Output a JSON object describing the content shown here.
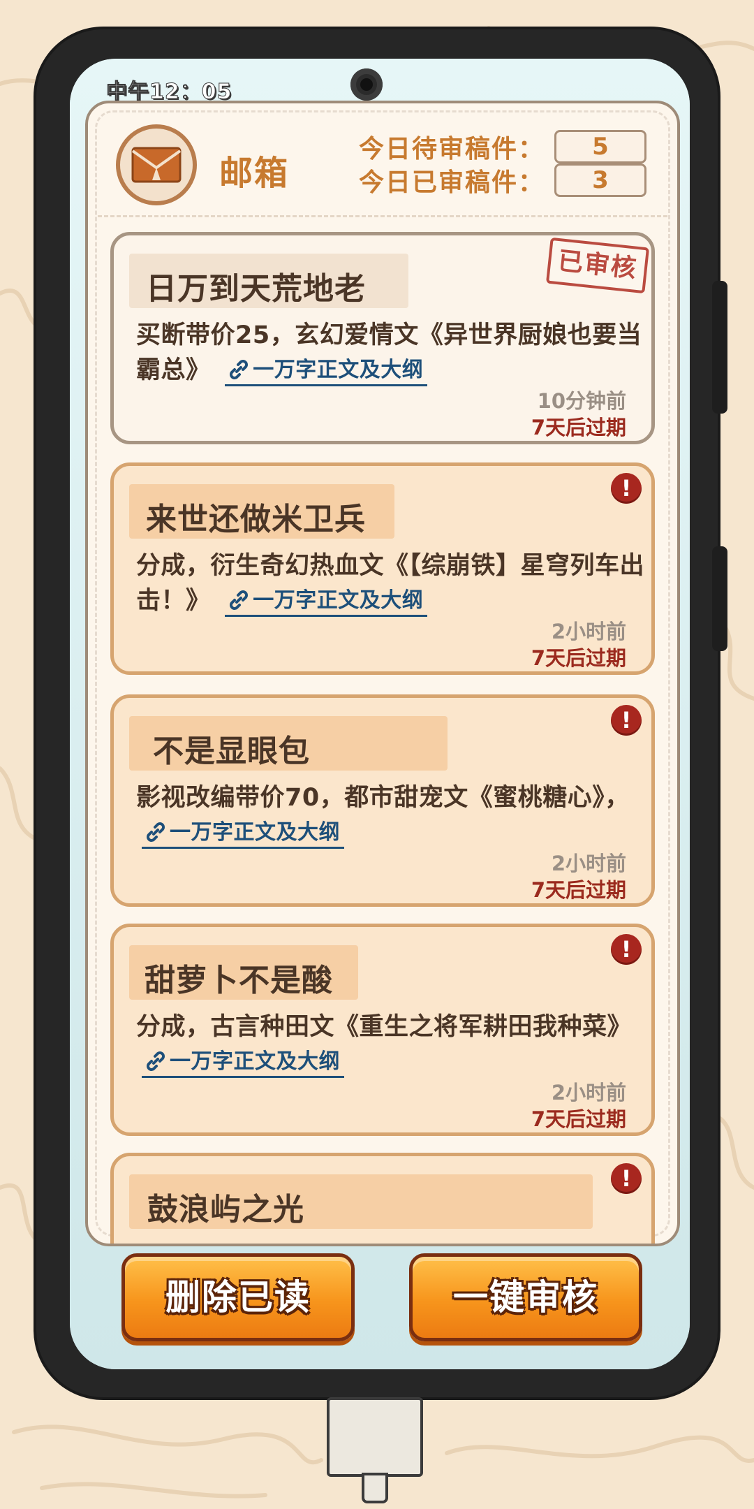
{
  "status_bar": {
    "time": "中午12：05"
  },
  "mailbox": {
    "title": "邮箱",
    "icon": "envelope-icon",
    "pending_label": "今日待审稿件：",
    "pending_count": "5",
    "reviewed_label": "今日已审稿件：",
    "reviewed_count": "3"
  },
  "mails": [
    {
      "title": "日万到天荒地老",
      "desc": "买断带价25，玄幻爱情文《异世界厨娘也要当霸总》",
      "link": "一万字正文及大纲",
      "time": "10分钟前",
      "expire": "7天后过期",
      "status": "已审核",
      "read": true
    },
    {
      "title": "来世还做米卫兵",
      "desc": "分成，衍生奇幻热血文《【综崩铁】星穹列车出击！》",
      "link": "一万字正文及大纲",
      "time": "2小时前",
      "expire": "7天后过期",
      "status_icon": "exclamation-icon",
      "read": false
    },
    {
      "title": "不是显眼包",
      "desc": "影视改编带价70，都市甜宠文《蜜桃糖心》，",
      "link": "一万字正文及大纲",
      "time": "2小时前",
      "expire": "7天后过期",
      "status_icon": "exclamation-icon",
      "read": false
    },
    {
      "title": "甜萝卜不是酸",
      "desc": "分成，古言种田文《重生之将军耕田我种菜》",
      "link": "一万字正文及大纲",
      "time": "2小时前",
      "expire": "7天后过期",
      "status_icon": "exclamation-icon",
      "read": false
    },
    {
      "title": "鼓浪屿之光",
      "status_icon": "exclamation-icon",
      "read": false
    }
  ],
  "buttons": {
    "delete_read": "删除已读",
    "review_all": "一键审核"
  },
  "colors": {
    "accent_orange": "#c77a2f",
    "button_orange": "#f7951c",
    "alert_red": "#a8271f",
    "link_blue": "#1d4f7a"
  }
}
